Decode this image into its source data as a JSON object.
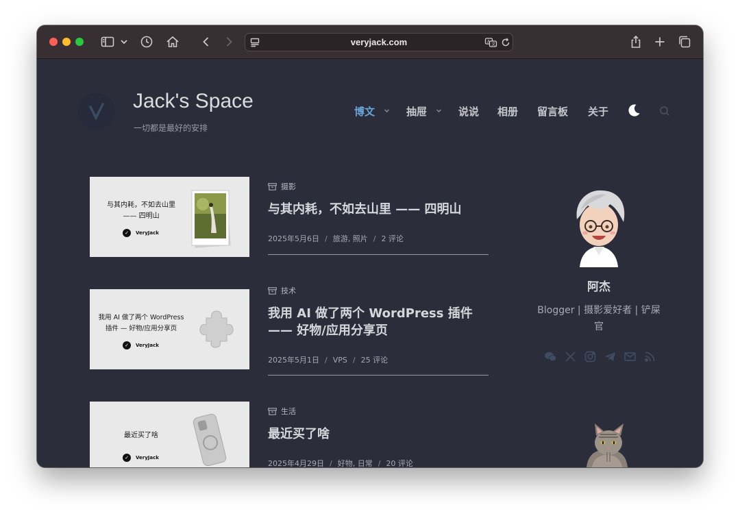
{
  "browser": {
    "url": "veryjack.com"
  },
  "site": {
    "title": "Jack's Space",
    "tagline": "一切都是最好的安排"
  },
  "nav": {
    "items": [
      {
        "label": "博文",
        "active": true,
        "has_dropdown": true
      },
      {
        "label": "抽屉",
        "active": false,
        "has_dropdown": true
      },
      {
        "label": "说说",
        "active": false,
        "has_dropdown": false
      },
      {
        "label": "相册",
        "active": false,
        "has_dropdown": false
      },
      {
        "label": "留言板",
        "active": false,
        "has_dropdown": false
      },
      {
        "label": "关于",
        "active": false,
        "has_dropdown": false
      }
    ]
  },
  "posts": [
    {
      "category": "摄影",
      "title": "与其内耗，不如去山里 —— 四明山",
      "date": "2025年5月6日",
      "tags": "旅游, 照片",
      "comments": "2 评论",
      "thumb_line1": "与其内耗，不如去山里",
      "thumb_line2": "—— 四明山",
      "thumb_brand": "VeryJack"
    },
    {
      "category": "技术",
      "title_line1": "我用 AI 做了两个 WordPress 插件",
      "title_line2": "—— 好物/应用分享页",
      "date": "2025年5月1日",
      "tags": "VPS",
      "comments": "25 评论",
      "thumb_line1": "我用 AI 做了两个 WordPress",
      "thumb_line2": "插件 — 好物/应用分享页",
      "thumb_brand": "VeryJack"
    },
    {
      "category": "生活",
      "title": "最近买了啥",
      "date": "2025年4月29日",
      "tags": "好物, 日常",
      "comments": "20 评论",
      "thumb_line1": "最近买了啥",
      "thumb_brand": "VeryJack"
    }
  ],
  "sidebar": {
    "author_name": "阿杰",
    "bio_line1": "Blogger | 摄影爱好者 | 铲屎",
    "bio_line2": "官"
  },
  "colors": {
    "page_bg": "#2c2d3b",
    "accent": "#6aa5d8",
    "toolbar_bg": "#382f33"
  }
}
